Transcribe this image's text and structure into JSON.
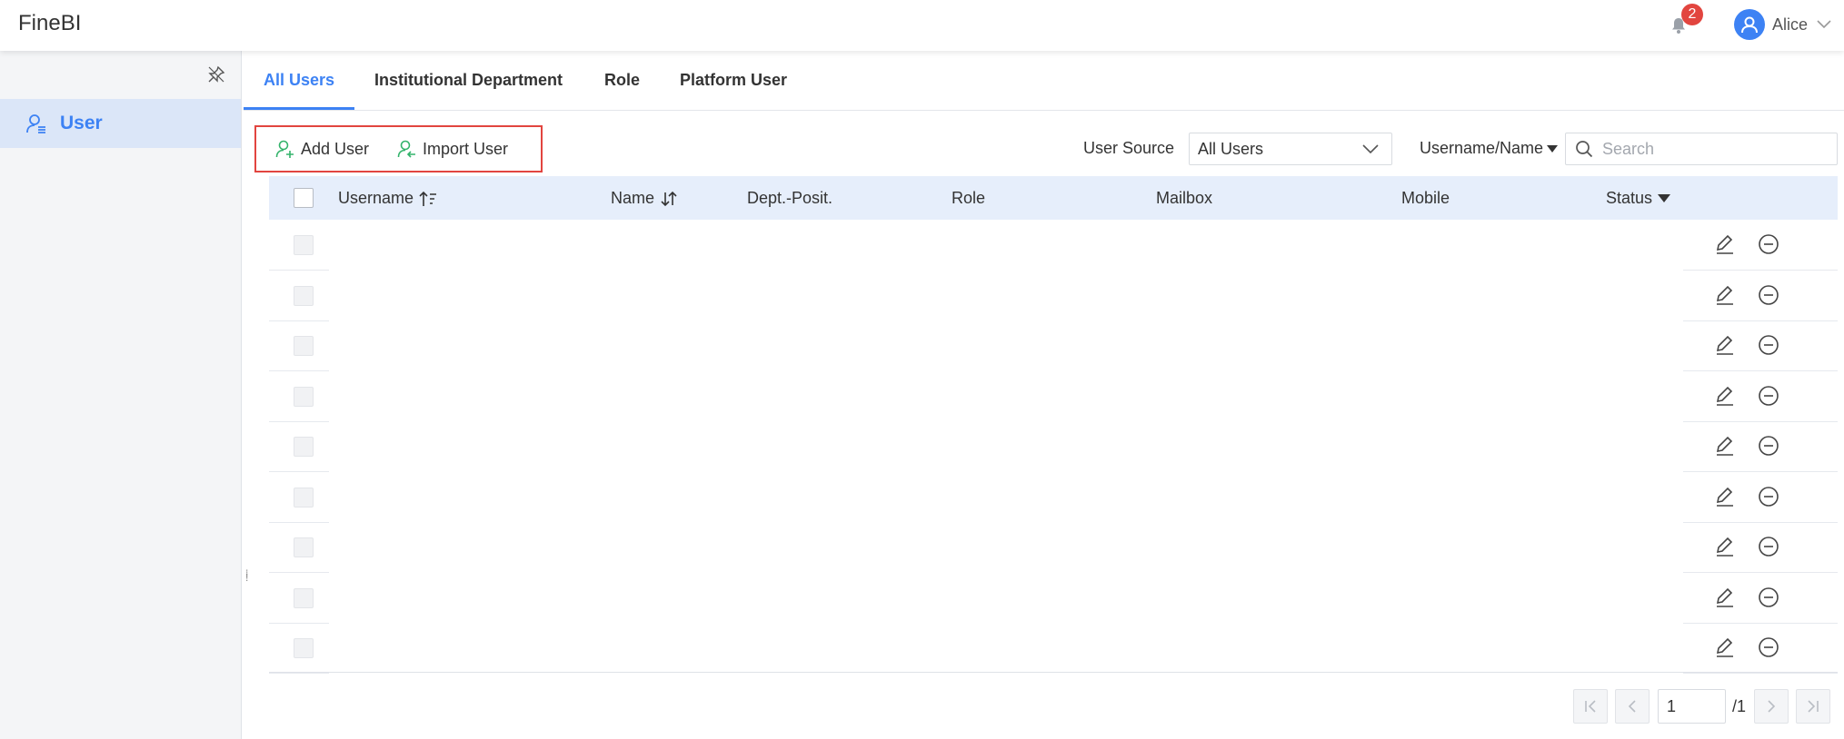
{
  "app": {
    "title": "FineBI"
  },
  "header": {
    "notification_count": "2",
    "user_name": "Alice",
    "icons": [
      "bell-icon",
      "avatar-icon",
      "chevron-down-icon"
    ]
  },
  "sidebar": {
    "items": [
      {
        "label": "User",
        "icon": "user-list-icon",
        "active": true
      }
    ]
  },
  "tabs": [
    {
      "label": "All Users",
      "active": true
    },
    {
      "label": "Institutional Department",
      "active": false
    },
    {
      "label": "Role",
      "active": false
    },
    {
      "label": "Platform User",
      "active": false
    }
  ],
  "toolbar": {
    "add_user_label": "Add User",
    "import_user_label": "Import User"
  },
  "filter": {
    "source_label": "User Source",
    "source_value": "All Users",
    "search_type": "Username/Name",
    "search_placeholder": "Search"
  },
  "table": {
    "columns": [
      "Username",
      "Name",
      "Dept.-Posit.",
      "Role",
      "Mailbox",
      "Mobile",
      "Status"
    ],
    "row_count": 9,
    "rows": [
      {
        "username": "",
        "name": "",
        "dept": "",
        "role": "",
        "mailbox": "",
        "mobile": "",
        "status": ""
      },
      {
        "username": "",
        "name": "",
        "dept": "",
        "role": "",
        "mailbox": "",
        "mobile": "",
        "status": ""
      },
      {
        "username": "",
        "name": "",
        "dept": "",
        "role": "",
        "mailbox": "",
        "mobile": "",
        "status": ""
      },
      {
        "username": "",
        "name": "",
        "dept": "",
        "role": "",
        "mailbox": "",
        "mobile": "",
        "status": ""
      },
      {
        "username": "",
        "name": "",
        "dept": "",
        "role": "",
        "mailbox": "",
        "mobile": "",
        "status": ""
      },
      {
        "username": "",
        "name": "",
        "dept": "",
        "role": "",
        "mailbox": "",
        "mobile": "",
        "status": ""
      },
      {
        "username": "",
        "name": "",
        "dept": "",
        "role": "",
        "mailbox": "",
        "mobile": "",
        "status": ""
      },
      {
        "username": "",
        "name": "",
        "dept": "",
        "role": "",
        "mailbox": "",
        "mobile": "",
        "status": ""
      },
      {
        "username": "",
        "name": "",
        "dept": "",
        "role": "",
        "mailbox": "",
        "mobile": "",
        "status": ""
      }
    ]
  },
  "pagination": {
    "current_page": "1",
    "total_label": "/1"
  },
  "colors": {
    "accent": "#3d82f4",
    "highlight_box": "#e2453f",
    "add_icon": "#33b36b",
    "badge": "#e2453f"
  }
}
